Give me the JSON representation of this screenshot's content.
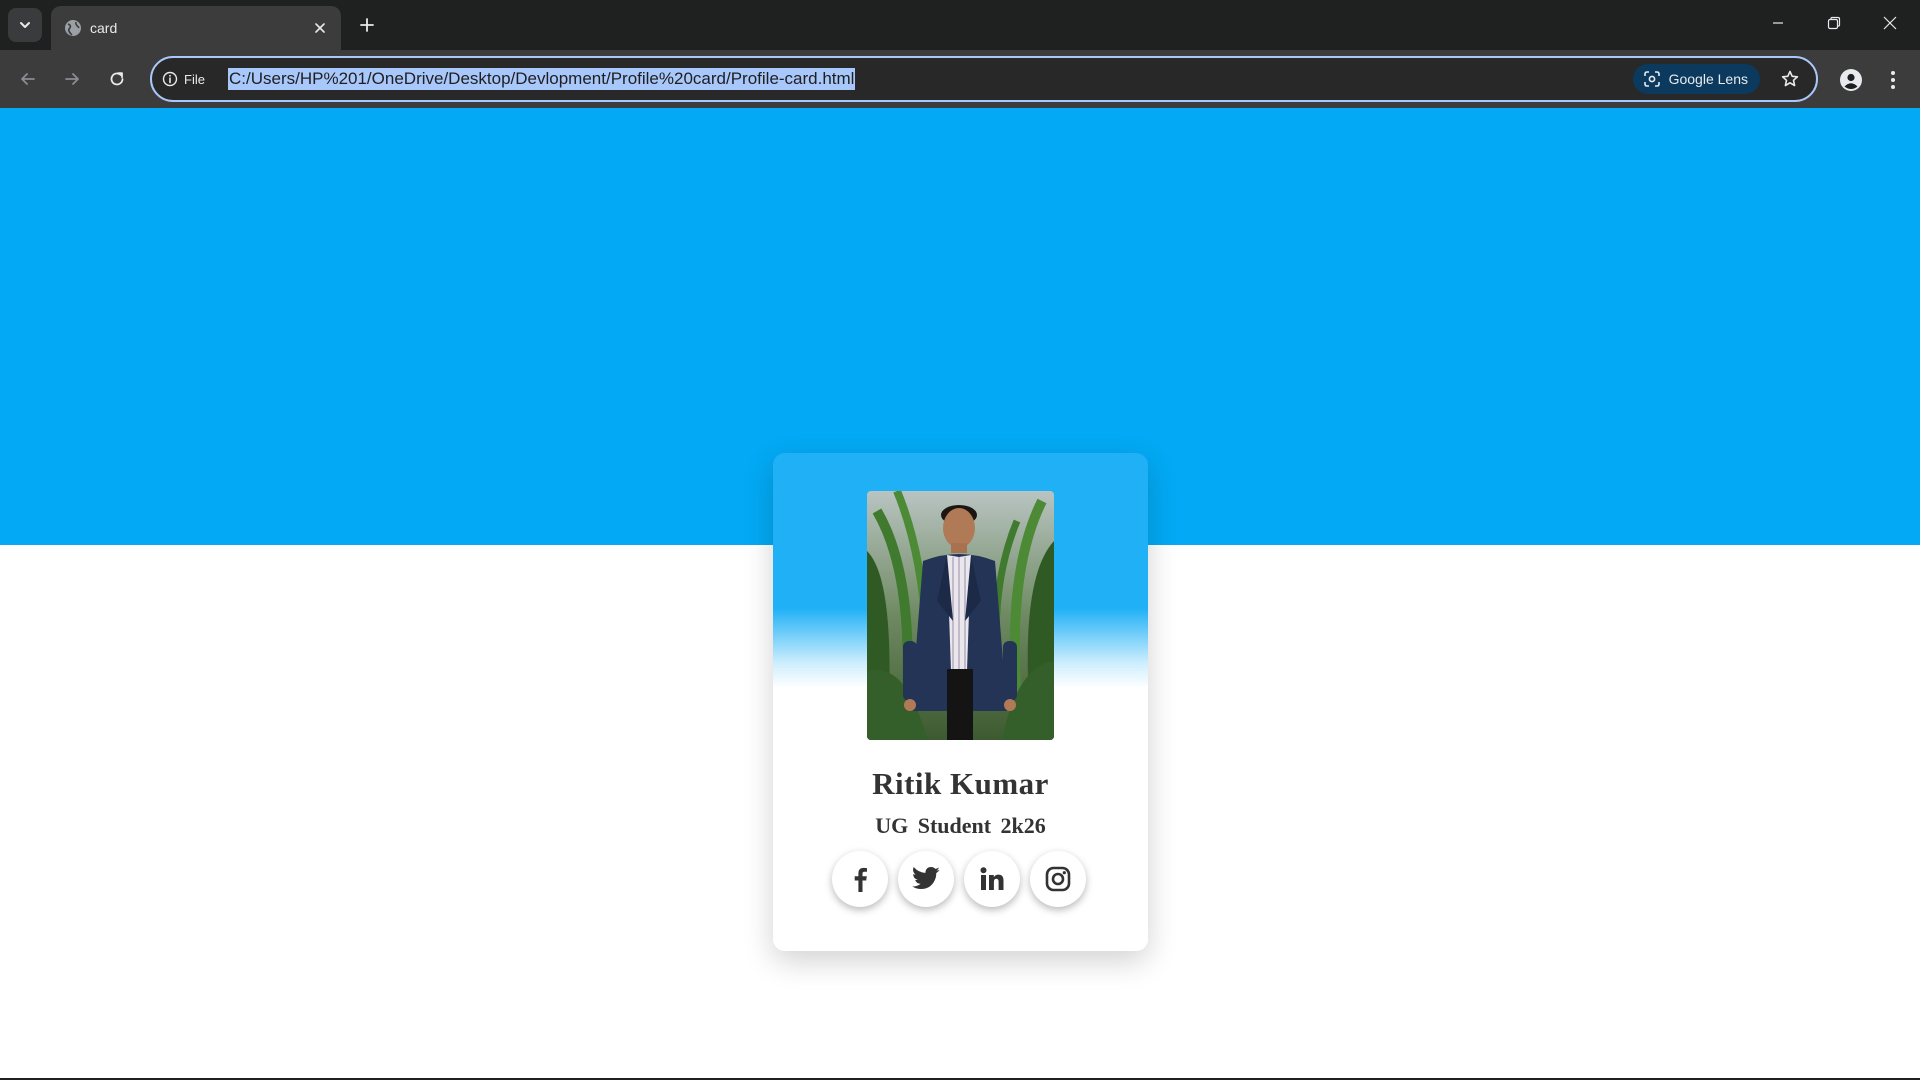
{
  "browser": {
    "tab": {
      "title": "card"
    },
    "address_bar": {
      "security_label": "File",
      "url": "C:/Users/HP%201/OneDrive/Desktop/Devlopment/Profile%20card/Profile-card.html"
    },
    "lens_label": "Google Lens"
  },
  "page": {
    "colors": {
      "hero": "#03a9f4",
      "card_top": "#1fb0f6",
      "text": "#333333"
    },
    "profile": {
      "name": "Ritik Kumar",
      "role": "UG Student  2k26"
    },
    "socials": [
      {
        "icon": "facebook-icon"
      },
      {
        "icon": "twitter-icon"
      },
      {
        "icon": "linkedin-icon"
      },
      {
        "icon": "instagram-icon"
      }
    ]
  }
}
